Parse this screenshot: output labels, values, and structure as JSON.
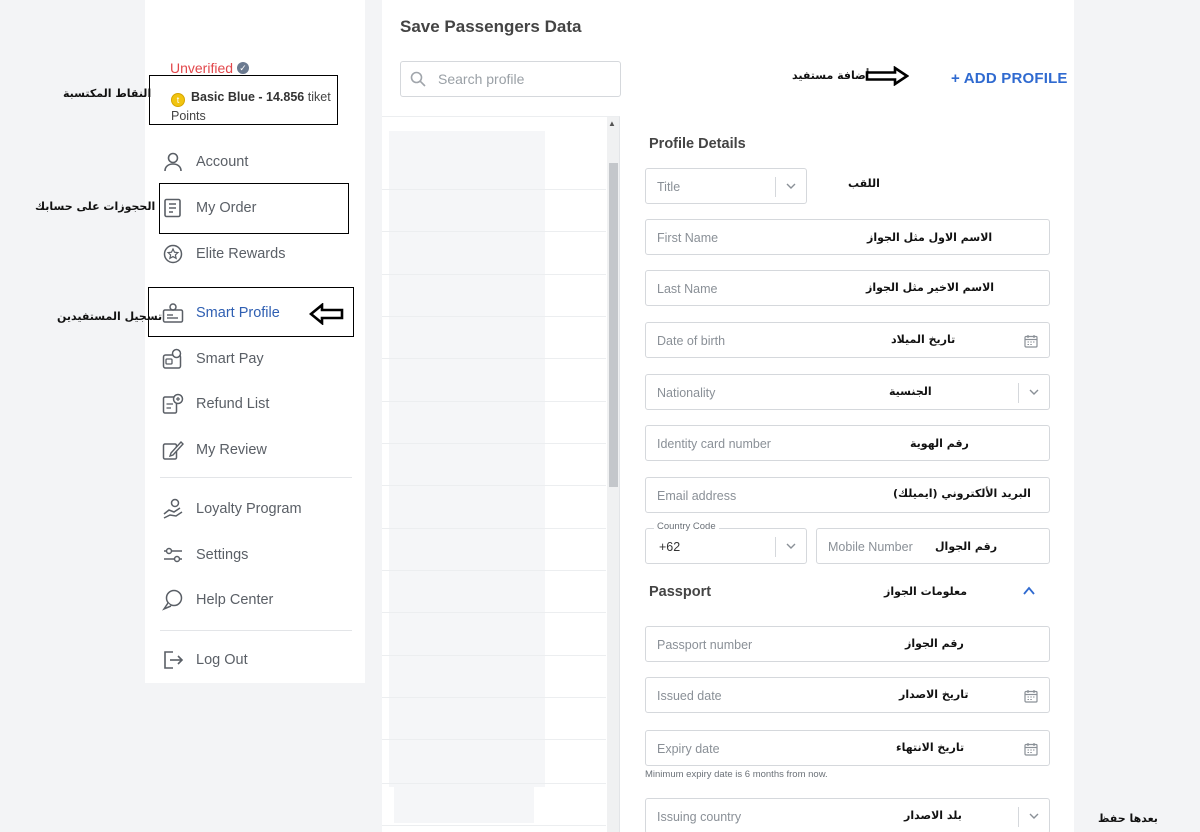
{
  "sidebar": {
    "status": "Unverified",
    "points_prefix": "Basic Blue - 14.856",
    "points_suffix": "tiket",
    "points_line2": "Points",
    "items": [
      {
        "label": "Account",
        "icon": "account-icon"
      },
      {
        "label": "My Order",
        "icon": "order-icon"
      },
      {
        "label": "Elite Rewards",
        "icon": "rewards-icon"
      },
      {
        "label": "Smart Profile",
        "icon": "profile-card-icon",
        "active": true
      },
      {
        "label": "Smart Pay",
        "icon": "wallet-icon"
      },
      {
        "label": "Refund List",
        "icon": "refund-icon"
      },
      {
        "label": "My Review",
        "icon": "review-icon"
      },
      {
        "label": "Loyalty Program",
        "icon": "loyalty-icon"
      },
      {
        "label": "Settings",
        "icon": "settings-icon"
      },
      {
        "label": "Help Center",
        "icon": "help-icon"
      },
      {
        "label": "Log Out",
        "icon": "logout-icon"
      }
    ]
  },
  "annotations": {
    "points": "النقاط المكتسبة",
    "bookings": "الحجوزات على حسابك",
    "register": "تسجيل المستفيدين",
    "add_beneficiary": "أضافة مستفيد",
    "title": "اللقب",
    "first_name": "الاسم الاول مثل الجواز",
    "last_name": "الاسم الاخير مثل الجواز",
    "dob": "تاريخ الميلاد",
    "nationality": "الجنسية",
    "id_number": "رقم الهوية",
    "email": "البريد الألكتروني (ايميلك)",
    "mobile": "رقم الجوال",
    "passport_info": "معلومات الجواز",
    "passport_number": "رقم الجواز",
    "issued_date": "تاريخ الاصدار",
    "expiry_date": "تاريخ الانتهاء",
    "issuing_country": "بلد الاصدار",
    "save_after": "بعدها حفظ"
  },
  "main": {
    "title": "Save Passengers Data",
    "search_placeholder": "Search profile",
    "add_profile": "+ ADD PROFILE",
    "details_title": "Profile Details",
    "fields": {
      "title": "Title",
      "first_name": "First Name",
      "last_name": "Last Name",
      "dob": "Date of birth",
      "nationality": "Nationality",
      "id_number": "Identity card number",
      "email": "Email address",
      "country_code_label": "Country Code",
      "country_code_value": "+62",
      "mobile": "Mobile Number"
    },
    "passport_title": "Passport",
    "passport_fields": {
      "number": "Passport number",
      "issued": "Issued date",
      "expiry": "Expiry date",
      "expiry_helper": "Minimum expiry date is 6 months from now.",
      "country": "Issuing country"
    }
  },
  "colors": {
    "accent": "#2f6ad0",
    "status_red": "#e2474b",
    "active_nav": "#2f5fb2"
  }
}
